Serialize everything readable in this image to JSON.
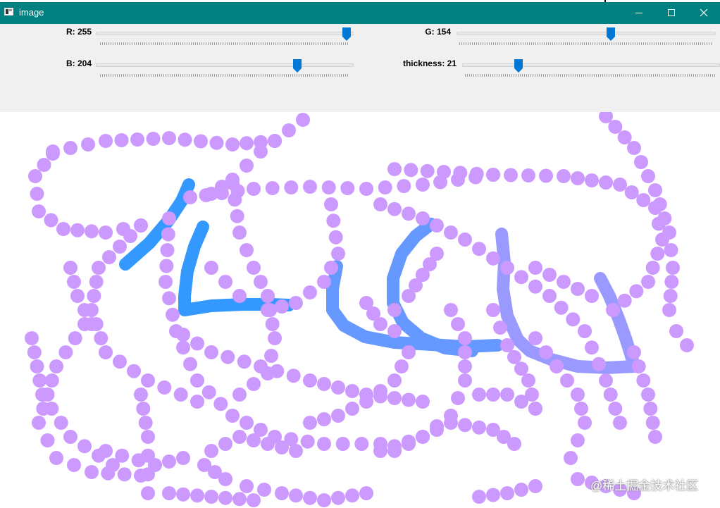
{
  "window": {
    "title": "image",
    "icon": "window-app-icon",
    "controls": [
      "minimize-icon",
      "maximize-icon",
      "close-icon"
    ]
  },
  "trackbars": {
    "r": {
      "label": "R: 255",
      "value": 255,
      "max": 255
    },
    "g": {
      "label": "G: 154",
      "value": 154,
      "max": 255
    },
    "b": {
      "label": "B: 204",
      "value": 204,
      "max": 255
    },
    "thickness": {
      "label": "thickness: 21",
      "value": 21,
      "max": 100
    }
  },
  "canvas": {
    "current_color": "#cc9aff",
    "stroke_colors": [
      "#cc9aff",
      "#3399ff",
      "#6699ff",
      "#9999ff"
    ]
  },
  "watermark": {
    "text": "@稀土掘金技术社区"
  },
  "colors": {
    "titlebar": "#008080",
    "panel": "#f0f0f0",
    "thumb": "#0078d7",
    "canvas_bg": "#ffffff"
  }
}
